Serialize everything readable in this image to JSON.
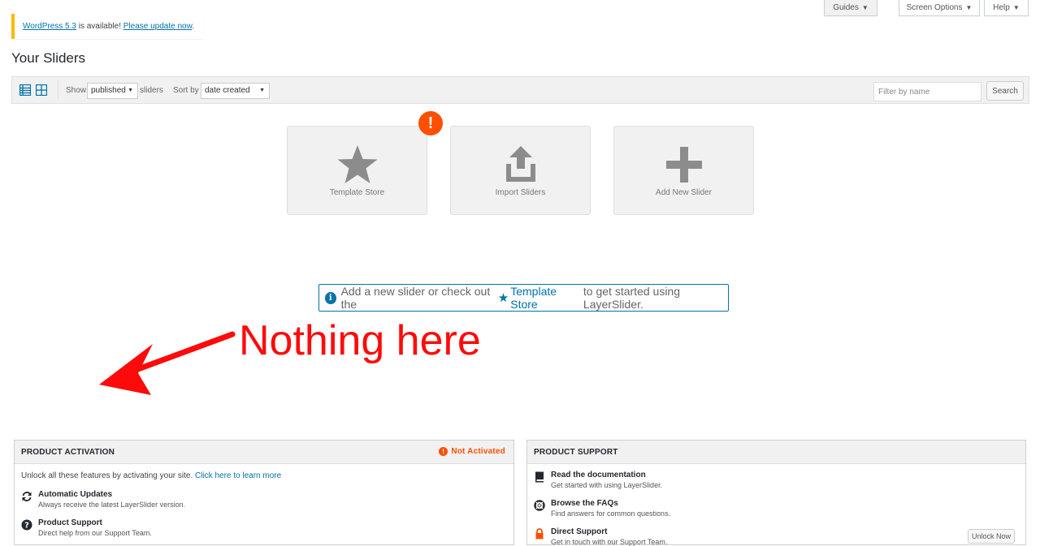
{
  "header_tabs": {
    "guides": "Guides",
    "screen_options": "Screen Options",
    "help": "Help"
  },
  "notice": {
    "version_link": "WordPress 5.3",
    "middle": " is available! ",
    "update_link": "Please update now",
    "end": "."
  },
  "page_title": "Your Sliders",
  "filter_bar": {
    "show_label": "Show",
    "status_value": "published",
    "sliders_label": "sliders",
    "sort_label": "Sort by",
    "sort_value": "date created",
    "filter_placeholder": "Filter by name",
    "search_button": "Search"
  },
  "cards": {
    "template_store": "Template Store",
    "import_sliders": "Import Sliders",
    "add_new_slider": "Add New Slider",
    "alert_badge": "!"
  },
  "info_notice": {
    "icon": "i",
    "before": "Add a new slider or check out the",
    "link": "Template Store",
    "after": "to get started using LayerSlider."
  },
  "annotation": {
    "text": "Nothing here",
    "color": "#ff0a0a"
  },
  "activation": {
    "title": "PRODUCT ACTIVATION",
    "status": "Not Activated",
    "intro": "Unlock all these features by activating your site.",
    "intro_link": "Click here to learn more",
    "items": [
      {
        "title": "Automatic Updates",
        "desc": "Always receive the latest LayerSlider version."
      },
      {
        "title": "Product Support",
        "desc": "Direct help from our Support Team."
      }
    ]
  },
  "support": {
    "title": "PRODUCT SUPPORT",
    "items": [
      {
        "title": "Read the documentation",
        "desc": "Get started with using LayerSlider."
      },
      {
        "title": "Browse the FAQs",
        "desc": "Find answers for common questions."
      },
      {
        "title": "Direct Support",
        "desc": "Get in touch with our Support Team."
      }
    ],
    "unlock_button": "Unlock Now"
  },
  "colors": {
    "accent": "#0073aa",
    "warning": "#ff4f00",
    "notice_border": "#ffb900"
  }
}
